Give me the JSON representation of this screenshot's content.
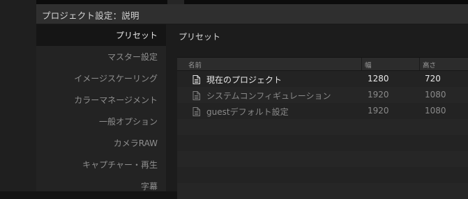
{
  "dialog": {
    "title": "プロジェクト設定：説明"
  },
  "sidebar": {
    "items": [
      {
        "label": "プリセット",
        "active": true
      },
      {
        "label": "マスター設定",
        "active": false
      },
      {
        "label": "イメージスケーリング",
        "active": false
      },
      {
        "label": "カラーマネージメント",
        "active": false
      },
      {
        "label": "一般オプション",
        "active": false
      },
      {
        "label": "カメラRAW",
        "active": false
      },
      {
        "label": "キャプチャー・再生",
        "active": false
      },
      {
        "label": "字幕",
        "active": false
      }
    ]
  },
  "main": {
    "section_title": "プリセット",
    "table": {
      "columns": [
        "名前",
        "幅",
        "高さ"
      ],
      "rows": [
        {
          "name": "現在のプロジェクト",
          "width": "1280",
          "height": "720",
          "icon": "document-icon"
        },
        {
          "name": "システムコンフィギュレーション",
          "width": "1920",
          "height": "1080",
          "icon": "document-icon"
        },
        {
          "name": "guestデフォルト設定",
          "width": "1920",
          "height": "1080",
          "icon": "document-icon"
        }
      ]
    }
  },
  "colors": {
    "background": "#141414",
    "dialog": "#232323",
    "titlebar": "#2f2f2f",
    "active_nav": "#151515",
    "text_primary": "#e8e8e8",
    "text_secondary": "#8a8a8a"
  }
}
